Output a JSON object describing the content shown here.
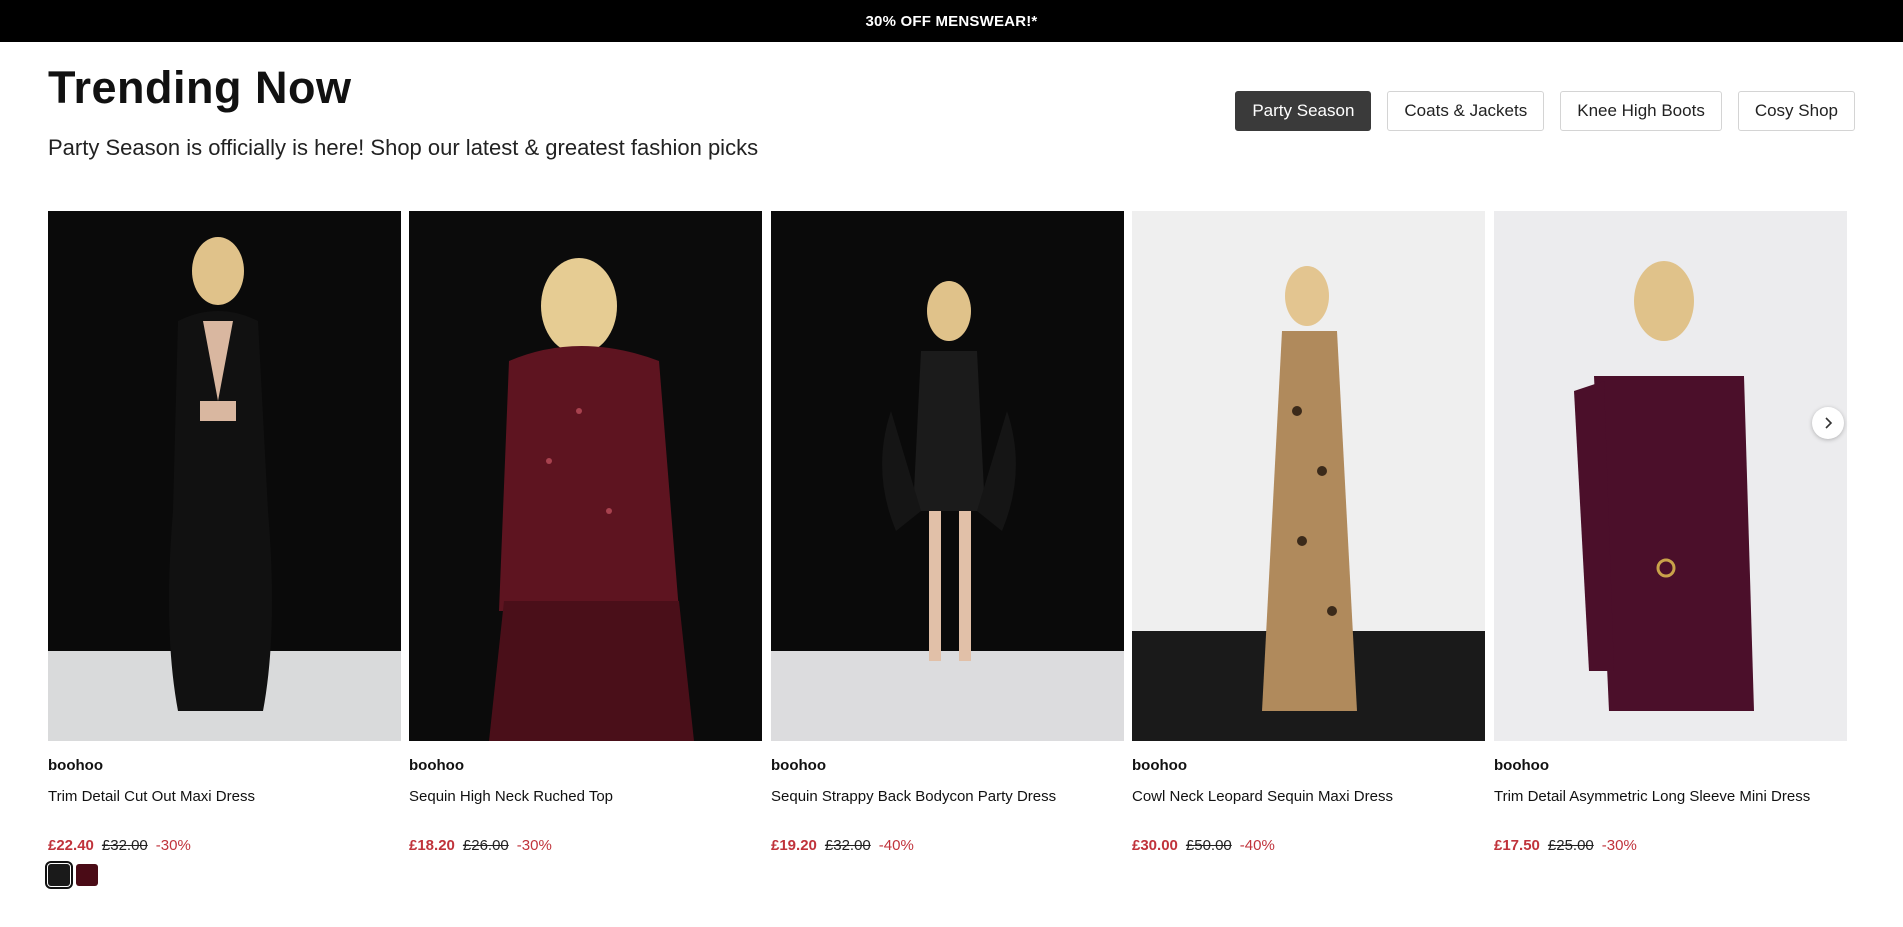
{
  "promo": {
    "text": "30% OFF MENSWEAR!*"
  },
  "header": {
    "title": "Trending Now",
    "subtitle": "Party Season is officially is here! Shop our latest & greatest fashion picks"
  },
  "tabs": [
    {
      "label": "Party Season",
      "active": true
    },
    {
      "label": "Coats & Jackets",
      "active": false
    },
    {
      "label": "Knee High Boots",
      "active": false
    },
    {
      "label": "Cosy Shop",
      "active": false
    }
  ],
  "products": [
    {
      "brand": "boohoo",
      "name": "Trim Detail Cut Out Maxi Dress",
      "price": "£22.40",
      "was": "£32.00",
      "discount": "-30%",
      "swatches": [
        "#1a1a1a",
        "#4a0b16"
      ]
    },
    {
      "brand": "boohoo",
      "name": "Sequin High Neck Ruched Top",
      "price": "£18.20",
      "was": "£26.00",
      "discount": "-30%",
      "swatches": []
    },
    {
      "brand": "boohoo",
      "name": "Sequin Strappy Back Bodycon Party Dress",
      "price": "£19.20",
      "was": "£32.00",
      "discount": "-40%",
      "swatches": []
    },
    {
      "brand": "boohoo",
      "name": "Cowl Neck Leopard Sequin Maxi Dress",
      "price": "£30.00",
      "was": "£50.00",
      "discount": "-40%",
      "swatches": []
    },
    {
      "brand": "boohoo",
      "name": "Trim Detail Asymmetric Long Sleeve Mini Dress",
      "price": "£17.50",
      "was": "£25.00",
      "discount": "-30%",
      "swatches": []
    }
  ],
  "colors": {
    "sale_red": "#c0333b",
    "active_tab": "#3a3a3a",
    "promo_bg": "#000000"
  },
  "icons": {
    "next": "chevron-right-icon"
  }
}
